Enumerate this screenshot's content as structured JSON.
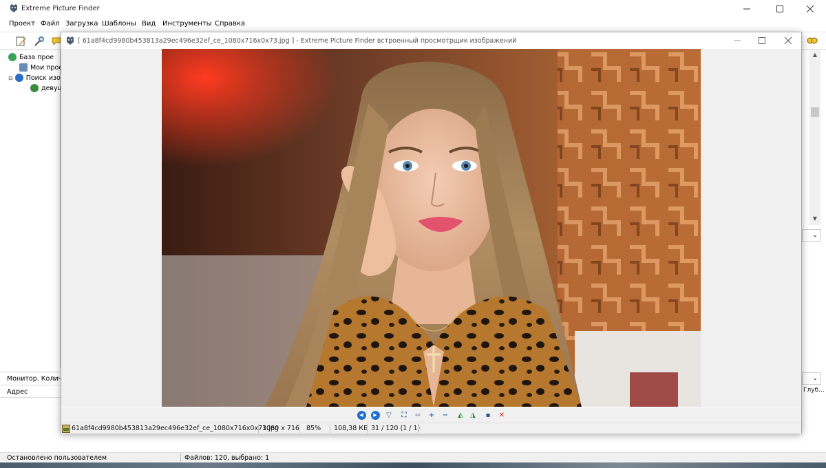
{
  "main_window": {
    "title": "Extreme Picture Finder",
    "menu": [
      "Проект",
      "Файл",
      "Загрузка",
      "Шаблоны",
      "Вид",
      "Инструменты",
      "Справка"
    ],
    "tree": [
      {
        "label": "База прое",
        "icon": "globe-project-icon",
        "color": "#3aa35a"
      },
      {
        "label": "Мои проек",
        "icon": "projects-icon",
        "color": "#6a8ab8"
      },
      {
        "label": "Поиск изо",
        "icon": "search-globe-icon",
        "color": "#2a6fc4"
      },
      {
        "label": "девуш",
        "icon": "search-magnifier-icon",
        "color": "#3a8a3a"
      }
    ],
    "monitor_label": "Монитор. Количе",
    "address_header": "Адрес",
    "right_column_header": "Глуб...",
    "status_left": "Остановлено пользователем",
    "status_right": "Файлов: 120, выбрано: 1"
  },
  "viewer": {
    "title": "[ 61a8f4cd9980b453813a29ec496e32ef_ce_1080x716x0x73.jpg ] - Extreme Picture Finder встроенный просмотрщик изображений",
    "status": {
      "filename": "61a8f4cd9980b453813a29ec496e32ef_ce_1080x716x0x73.jpg",
      "dimensions": "1080 x 716",
      "zoom": "85%",
      "size": "108,38 КБ",
      "position": "31 / 120 (1 / 1)"
    },
    "toolbar": [
      {
        "name": "previous-image-button",
        "icon": "previous-icon",
        "glyph": "◀",
        "color": "#1f6fd1"
      },
      {
        "name": "next-image-button",
        "icon": "next-icon",
        "glyph": "▶",
        "color": "#1f6fd1"
      },
      {
        "name": "slideshow-button",
        "icon": "slideshow-icon",
        "glyph": "▽",
        "color": "#5b6f9c"
      },
      {
        "name": "fit-window-button",
        "icon": "fit-icon",
        "glyph": "⛶",
        "color": "#2d6fb0"
      },
      {
        "name": "fit-width-button",
        "icon": "fit-width-icon",
        "glyph": "⇔",
        "color": "#9aa"
      },
      {
        "name": "zoom-in-button",
        "icon": "zoom-in-icon",
        "glyph": "+",
        "color": "#2d6fb0"
      },
      {
        "name": "zoom-out-button",
        "icon": "zoom-out-icon",
        "glyph": "−",
        "color": "#2d6fb0"
      },
      {
        "name": "rotate-left-button",
        "icon": "rotate-left-icon",
        "glyph": "◭",
        "color": "#2a8a3a"
      },
      {
        "name": "rotate-right-button",
        "icon": "rotate-right-icon",
        "glyph": "◮",
        "color": "#2a8a3a"
      },
      {
        "name": "save-button",
        "icon": "save-icon",
        "glyph": "▪",
        "color": "#2a4f9c"
      },
      {
        "name": "delete-button",
        "icon": "delete-icon",
        "glyph": "✕",
        "color": "#d11f1f"
      }
    ]
  }
}
